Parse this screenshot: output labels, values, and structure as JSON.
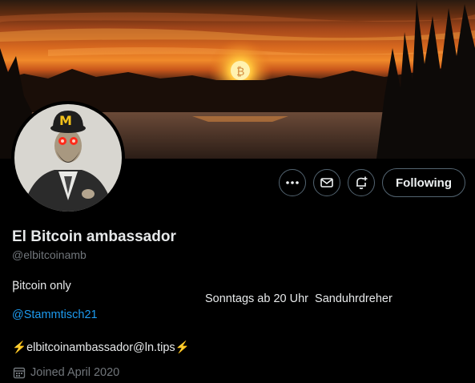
{
  "profile": {
    "name": "El Bitcoin ambassador",
    "handle": "@elbitcoinamb",
    "bio": {
      "line1": "Ꞵitcoin only",
      "line2": "Sonntags ab 20 Uhr  Sanduhrdreher",
      "mention": "@Stammtisch21",
      "lightning_prefix": "⚡",
      "lightning_address": "elbitcoinambassador@ln.tips",
      "lightning_suffix": "⚡"
    },
    "joined": "Joined April 2020"
  },
  "actions": {
    "more_icon": "more-icon",
    "message_icon": "envelope-icon",
    "notify_icon": "bell-plus-icon",
    "following_label": "Following"
  },
  "colors": {
    "background": "#000000",
    "link": "#1d9bf0",
    "muted": "#71767b",
    "text": "#e7e9ea"
  }
}
